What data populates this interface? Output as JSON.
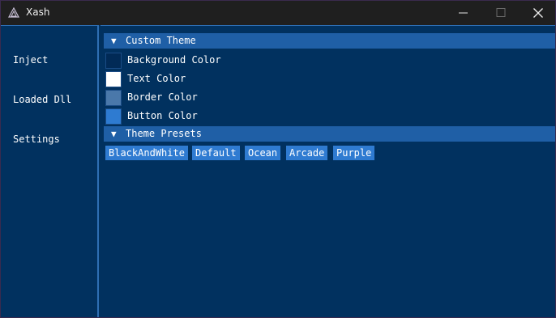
{
  "window": {
    "title": "Xash"
  },
  "sidebar": {
    "items": [
      {
        "label": "Inject"
      },
      {
        "label": "Loaded Dll"
      },
      {
        "label": "Settings"
      }
    ]
  },
  "custom_theme": {
    "header": "Custom Theme",
    "colors": [
      {
        "label": "Background Color",
        "value": "#012a56"
      },
      {
        "label": "Text Color",
        "value": "#ffffff"
      },
      {
        "label": "Border Color",
        "value": "#4a78aa"
      },
      {
        "label": "Button Color",
        "value": "#2e7bd1"
      }
    ]
  },
  "theme_presets": {
    "header": "Theme Presets",
    "buttons": [
      "BlackAndWhite",
      "Default",
      "Ocean",
      "Arcade",
      "Purple"
    ]
  },
  "colors": {
    "titlebar": "#1f1f1f",
    "client_bg": "#01315f",
    "header_bg": "#1f5fa6",
    "button_bg": "#2f7bd1",
    "border_accent": "#2e6fb4"
  },
  "icons": {
    "app": "app-logo-icon",
    "minimize": "minimize-icon",
    "maximize": "maximize-icon",
    "close": "close-icon"
  }
}
